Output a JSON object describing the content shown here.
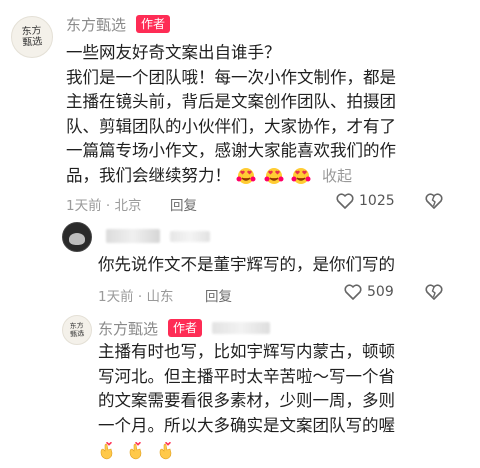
{
  "comments": [
    {
      "avatar_text": "东方甄选",
      "username": "东方甄选",
      "badge": "作者",
      "lines": [
        "一些网友好奇文案出自谁手？",
        "我们是一个团队哦！每一次小作文制作，都是",
        "主播在镜头前，背后是文案创作团队、拍摄团",
        "队、剪辑团队的小伙伴们，大家协作，才有了",
        "一篇篇专场小作文，感谢大家能喜欢我们的作",
        "品，我们会继续努力！"
      ],
      "collapse_label": "收起",
      "time_location": "1天前 · 北京",
      "reply_label": "回复",
      "like_count": "1025"
    },
    {
      "text": "你先说作文不是董宇辉写的，是你们写的",
      "time_location": "1天前 · 山东",
      "reply_label": "回复",
      "like_count": "509"
    },
    {
      "avatar_text": "东方甄选",
      "username": "东方甄选",
      "badge": "作者",
      "lines": [
        "主播有时也写，比如宇辉写内蒙古，顿顿",
        "写河北。但主播平时太辛苦啦～写一个省",
        "的文案需要看很多素材，少则一周，多则",
        "一个月。所以大多确实是文案团队写的喔"
      ]
    }
  ],
  "icons": {
    "heart": "heart-outline-icon",
    "dislike": "broken-heart-icon",
    "emoji": "heart-eyes-emoji",
    "hand": "finger-heart-emoji"
  },
  "colors": {
    "badge": "#fe2c55",
    "meta": "#9a9a9a"
  }
}
